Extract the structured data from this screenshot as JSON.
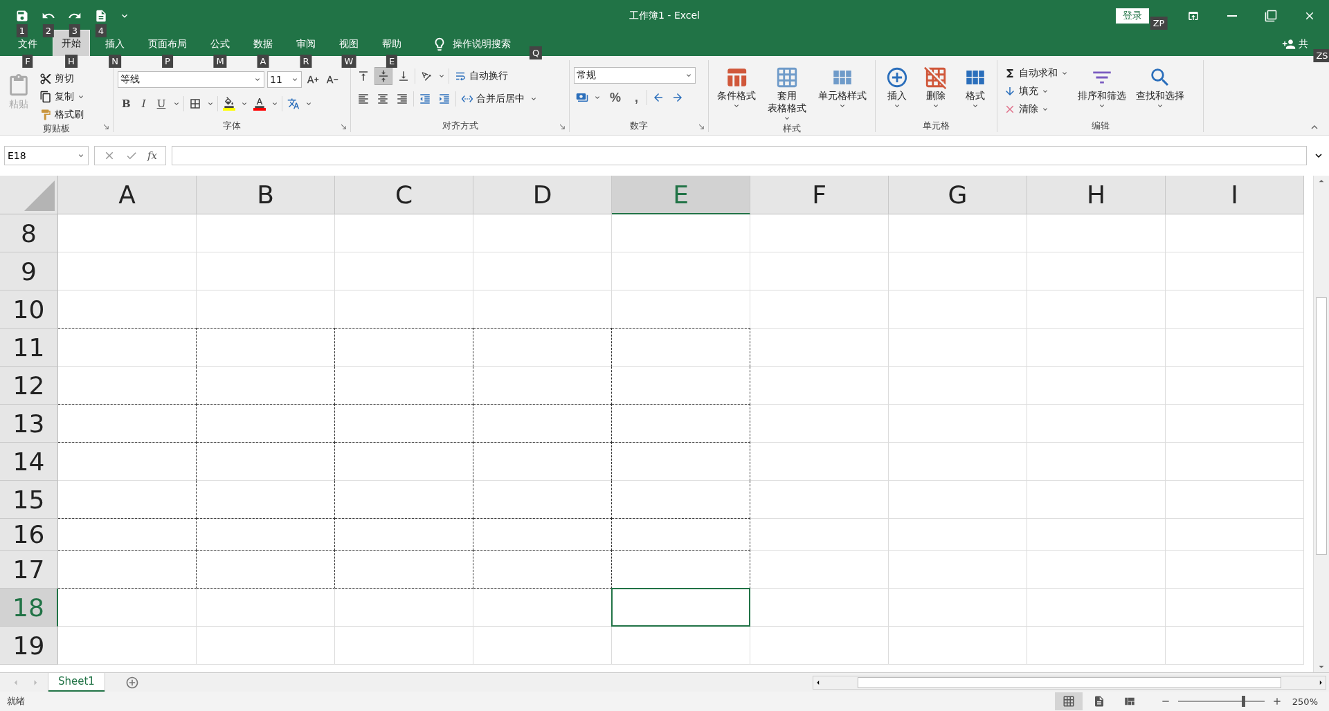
{
  "quick_access": {
    "keytips": [
      "1",
      "2",
      "3",
      "4"
    ]
  },
  "window": {
    "title": "工作簿1  -  Excel",
    "login": "登录",
    "login_keytip": "ZP"
  },
  "tabs": [
    {
      "label": "文件",
      "keytip": "F",
      "selected": false
    },
    {
      "label": "开始",
      "keytip": "H",
      "selected": true
    },
    {
      "label": "插入",
      "keytip": "N",
      "selected": false
    },
    {
      "label": "页面布局",
      "keytip": "P",
      "selected": false
    },
    {
      "label": "公式",
      "keytip": "M",
      "selected": false
    },
    {
      "label": "数据",
      "keytip": "A",
      "selected": false
    },
    {
      "label": "审阅",
      "keytip": "R",
      "selected": false
    },
    {
      "label": "视图",
      "keytip": "W",
      "selected": false
    },
    {
      "label": "帮助",
      "keytip": "E",
      "selected": false
    }
  ],
  "search": {
    "label": "操作说明搜索",
    "keytip": "Q"
  },
  "share": {
    "label": "共",
    "keytip": "ZS"
  },
  "ribbon": {
    "clipboard": {
      "label": "剪贴板",
      "paste": "粘贴",
      "cut": "剪切",
      "copy": "复制",
      "format_painter": "格式刷"
    },
    "font": {
      "label": "字体",
      "font_name": "等线",
      "font_size": "11",
      "styles": [
        {
          "label": "B",
          "kind": "bold"
        },
        {
          "label": "I",
          "kind": "italic"
        },
        {
          "label": "U",
          "kind": "underline"
        }
      ]
    },
    "alignment": {
      "label": "对齐方式",
      "wrap": "自动换行",
      "merge": "合并后居中"
    },
    "number": {
      "label": "数字",
      "format": "常规",
      "symbols": [
        "%",
        ","
      ]
    },
    "styles": {
      "label": "样式",
      "buttons": [
        {
          "lines": [
            "条件格式"
          ]
        },
        {
          "lines": [
            "套用",
            "表格格式"
          ]
        },
        {
          "lines": [
            "单元格样式"
          ]
        }
      ]
    },
    "cells": {
      "label": "单元格",
      "buttons": [
        "插入",
        "删除",
        "格式"
      ]
    },
    "editing": {
      "label": "编辑",
      "autosum": "自动求和",
      "fill": "填充",
      "clear": "清除",
      "sort": "排序和筛选",
      "find": "查找和选择"
    }
  },
  "formula_bar": {
    "name_box": "E18",
    "fx": "fx"
  },
  "columns": [
    {
      "label": "A",
      "selected": false,
      "print_area": true
    },
    {
      "label": "B",
      "selected": false,
      "print_area": true
    },
    {
      "label": "C",
      "selected": false,
      "print_area": true
    },
    {
      "label": "D",
      "selected": false,
      "print_area": true
    },
    {
      "label": "E",
      "selected": true,
      "print_area": true
    },
    {
      "label": "F",
      "selected": false,
      "print_area": false
    },
    {
      "label": "G",
      "selected": false,
      "print_area": false
    },
    {
      "label": "H",
      "selected": false,
      "print_area": false
    },
    {
      "label": "I",
      "selected": false,
      "print_area": false
    }
  ],
  "rows": [
    {
      "label": "8",
      "selected": false,
      "short": false,
      "print_area": false,
      "dashed_top": false
    },
    {
      "label": "9",
      "selected": false,
      "short": false,
      "print_area": false,
      "dashed_top": false
    },
    {
      "label": "10",
      "selected": false,
      "short": false,
      "print_area": false,
      "dashed_top": false
    },
    {
      "label": "11",
      "selected": false,
      "short": false,
      "print_area": true,
      "dashed_top": true
    },
    {
      "label": "12",
      "selected": false,
      "short": false,
      "print_area": true,
      "dashed_top": false
    },
    {
      "label": "13",
      "selected": false,
      "short": false,
      "print_area": true,
      "dashed_top": true
    },
    {
      "label": "14",
      "selected": false,
      "short": false,
      "print_area": true,
      "dashed_top": true
    },
    {
      "label": "15",
      "selected": false,
      "short": false,
      "print_area": true,
      "dashed_top": false
    },
    {
      "label": "16",
      "selected": false,
      "short": true,
      "print_area": true,
      "dashed_top": true
    },
    {
      "label": "17",
      "selected": false,
      "short": false,
      "print_area": true,
      "dashed_top": true
    },
    {
      "label": "18",
      "selected": true,
      "short": false,
      "print_area": false,
      "dashed_top": true
    },
    {
      "label": "19",
      "selected": false,
      "short": false,
      "print_area": false,
      "dashed_top": false
    }
  ],
  "sheets": [
    {
      "label": "Sheet1",
      "selected": true
    }
  ],
  "status_bar": {
    "status": "就绪",
    "zoom": {
      "level": 0.75,
      "reading": "250%"
    }
  }
}
